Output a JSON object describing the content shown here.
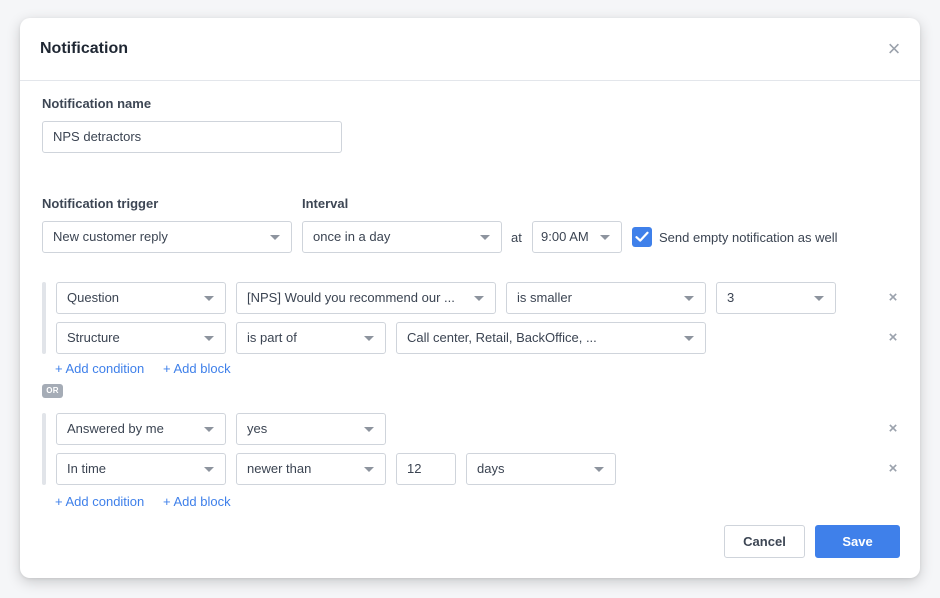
{
  "dialog": {
    "title": "Notification",
    "close_symbol": "×"
  },
  "form": {
    "name_label": "Notification name",
    "name_value": "NPS detractors",
    "trigger_label": "Notification trigger",
    "trigger_value": "New customer reply",
    "interval_label": "Interval",
    "interval_value": "once in a day",
    "at_label": "at",
    "time_value": "9:00 AM",
    "send_empty_label": "Send empty notification as well",
    "send_empty_checked": true
  },
  "blocks": [
    {
      "conditions": [
        {
          "field": "Question",
          "operator": "[NPS] Would you recommend our ...",
          "comparator": "is smaller",
          "value": "3"
        },
        {
          "field": "Structure",
          "operator": "is part of",
          "value": "Call center, Retail, BackOffice, ..."
        }
      ],
      "add_condition": "+ Add condition",
      "add_block": "+ Add block"
    },
    {
      "conditions": [
        {
          "field": "Answered by me",
          "value": "yes"
        },
        {
          "field": "In time",
          "operator": "newer than",
          "number": "12",
          "unit": "days"
        }
      ],
      "add_condition": "+ Add condition",
      "add_block": "+ Add block"
    }
  ],
  "or_label": "OR",
  "remove_symbol": "×",
  "actions": {
    "cancel": "Cancel",
    "save": "Save"
  },
  "colors": {
    "accent": "#3f80ea",
    "border": "#cfd4db",
    "badge": "#a5acb6"
  }
}
